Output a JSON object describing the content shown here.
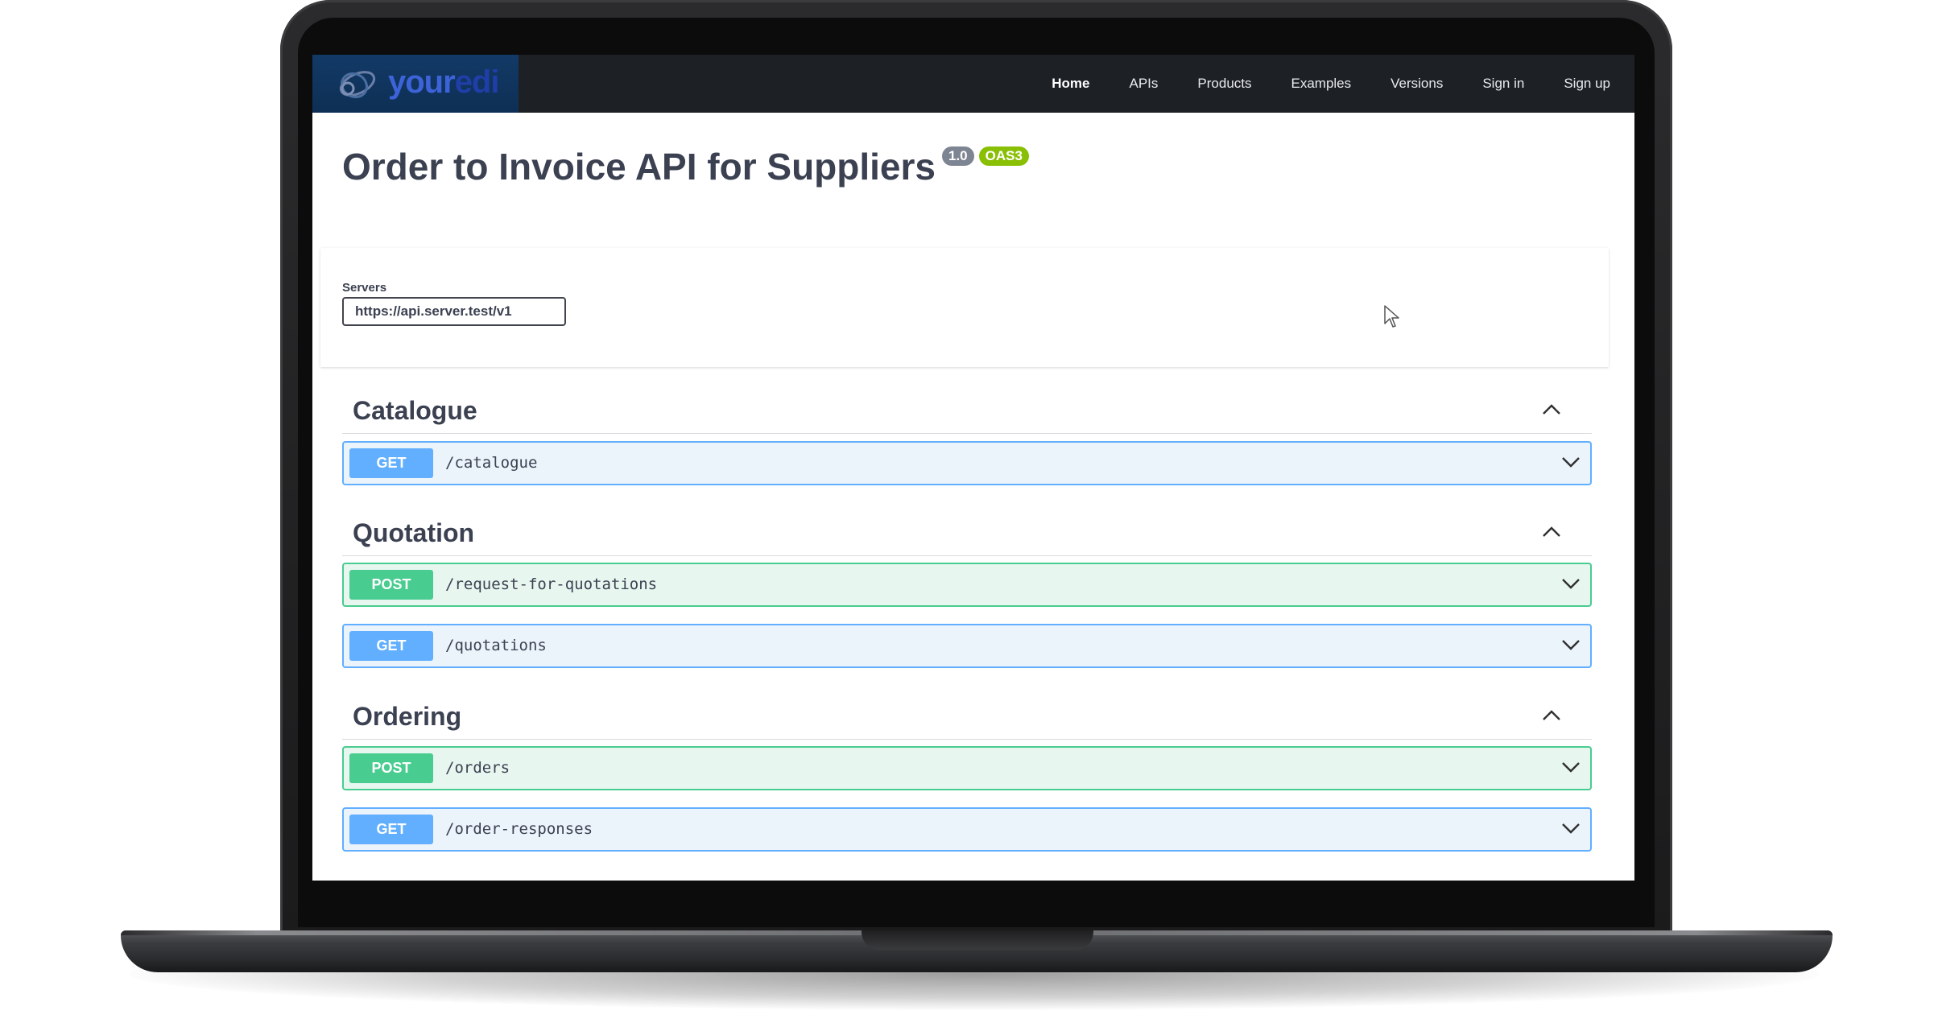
{
  "nav": {
    "logo_part1": "your",
    "logo_part2": "edi",
    "items": [
      "Home",
      "APIs",
      "Products",
      "Examples",
      "Versions",
      "Sign in",
      "Sign up"
    ],
    "active": "Home"
  },
  "api": {
    "title": "Order to Invoice API for Suppliers",
    "version_badge": "1.0",
    "oas_badge": "OAS3"
  },
  "servers": {
    "label": "Servers",
    "selected": "https://api.server.test/v1"
  },
  "sections": [
    {
      "name": "Catalogue",
      "operations": [
        {
          "method": "GET",
          "path": "/catalogue"
        }
      ]
    },
    {
      "name": "Quotation",
      "operations": [
        {
          "method": "POST",
          "path": "/request-for-quotations"
        },
        {
          "method": "GET",
          "path": "/quotations"
        }
      ]
    },
    {
      "name": "Ordering",
      "operations": [
        {
          "method": "POST",
          "path": "/orders"
        },
        {
          "method": "GET",
          "path": "/order-responses"
        }
      ]
    }
  ],
  "colors": {
    "get": "#61affe",
    "post": "#49cc90",
    "topbar": "#1d2126",
    "logo_bg": "#123a66"
  },
  "icons": [
    "youredi-logo-icon",
    "chevron-up-icon",
    "chevron-down-icon",
    "mouse-cursor-icon"
  ]
}
